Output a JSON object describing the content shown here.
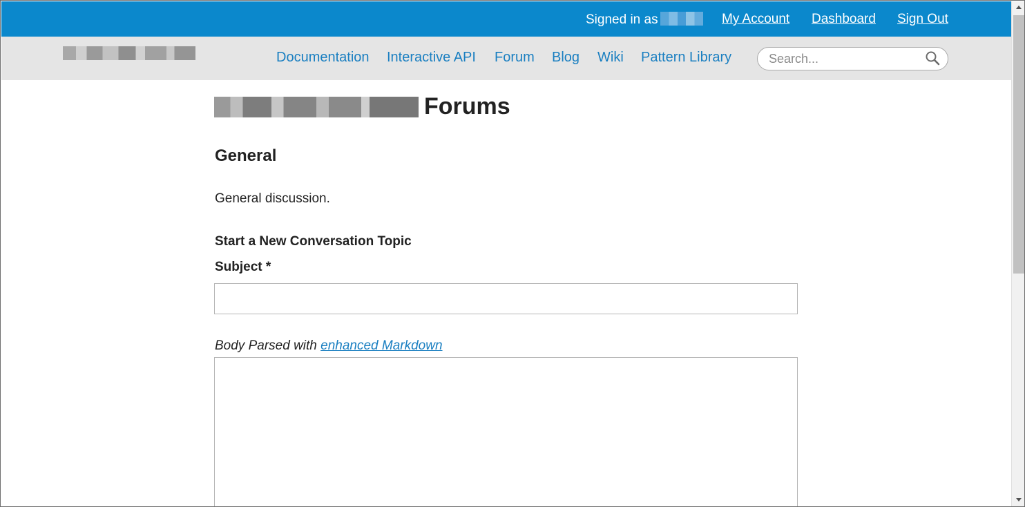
{
  "topbar": {
    "signed_in_text": "Signed in as",
    "links": [
      "My Account",
      "Dashboard",
      "Sign Out"
    ],
    "color": "#0b88cc"
  },
  "nav": {
    "items": [
      "Documentation",
      "Interactive API",
      "Forum",
      "Blog",
      "Wiki",
      "Pattern Library"
    ],
    "search_placeholder": "Search...",
    "search_icon": "search-icon",
    "link_color": "#1a7fc1"
  },
  "page": {
    "title_suffix": "Forums",
    "category": "General",
    "description": "General discussion.",
    "form_heading": "Start a New Conversation Topic",
    "subject_label": "Subject *",
    "subject_value": "",
    "body_label_prefix": "Body Parsed with ",
    "body_label_link": "enhanced Markdown",
    "body_value": ""
  }
}
